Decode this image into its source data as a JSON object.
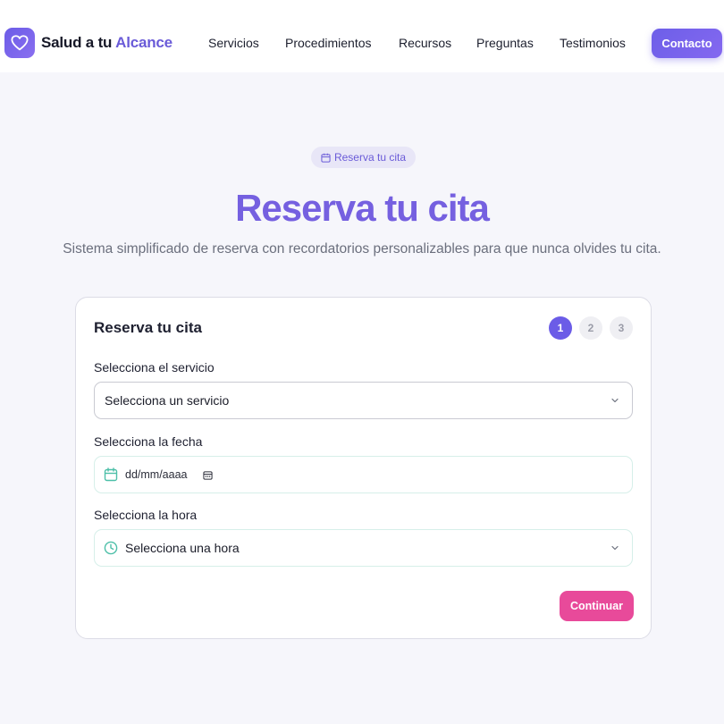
{
  "header": {
    "logo_text": "Salud a tu ",
    "logo_accent": "Alcance",
    "nav": [
      "Servicios",
      "Procedimientos",
      "Recursos",
      "Preguntas",
      "Testimonios"
    ],
    "contact_label": "Contacto"
  },
  "hero": {
    "badge": "Reserva tu cita",
    "title": "Reserva tu cita",
    "subtitle": "Sistema simplificado de reserva con recordatorios personalizables para que nunca olvides tu cita."
  },
  "form": {
    "title": "Reserva tu cita",
    "steps": [
      "1",
      "2",
      "3"
    ],
    "active_step": 1,
    "service_label": "Selecciona el servicio",
    "service_value": "Selecciona un servicio",
    "date_label": "Selecciona la fecha",
    "date_placeholder": "dd/mm/aaaa",
    "time_label": "Selecciona la hora",
    "time_value": "Selecciona una hora",
    "continue_label": "Continuar"
  },
  "colors": {
    "primary": "#6b5ce7",
    "accent_pink": "#e84a9a",
    "teal": "#4dbfa8",
    "background": "#f6f6fb"
  },
  "icons": [
    "heart-icon",
    "calendar-icon",
    "chevron-down-icon",
    "clock-icon"
  ]
}
